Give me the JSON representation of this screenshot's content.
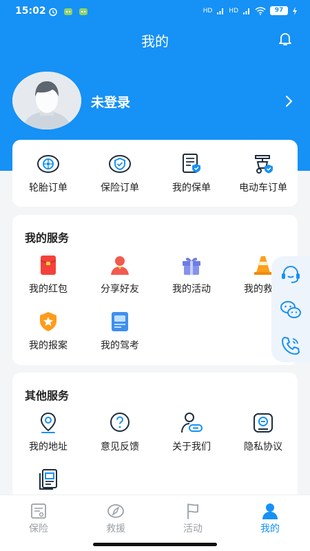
{
  "status_bar": {
    "time": "15:02",
    "battery": "97",
    "network_labels": [
      "HD",
      "HD"
    ]
  },
  "header": {
    "title": "我的",
    "bell_icon": "bell-icon"
  },
  "profile": {
    "name": "未登录",
    "avatar_icon": "avatar-placeholder-icon",
    "chevron_icon": "chevron-right-icon"
  },
  "orders": {
    "items": [
      {
        "label": "轮胎订单",
        "icon": "tire-icon"
      },
      {
        "label": "保险订单",
        "icon": "insurance-shield-icon"
      },
      {
        "label": "我的保单",
        "icon": "policy-document-icon"
      },
      {
        "label": "电动车订单",
        "icon": "ebike-icon"
      }
    ]
  },
  "my_services": {
    "title": "我的服务",
    "items": [
      {
        "label": "我的红包",
        "icon": "red-packet-icon"
      },
      {
        "label": "分享好友",
        "icon": "share-friend-icon"
      },
      {
        "label": "我的活动",
        "icon": "gift-icon"
      },
      {
        "label": "我的救援",
        "icon": "traffic-cone-icon"
      },
      {
        "label": "我的报案",
        "icon": "report-shield-icon"
      },
      {
        "label": "我的驾考",
        "icon": "driving-test-icon"
      }
    ]
  },
  "other_services": {
    "title": "其他服务",
    "items": [
      {
        "label": "我的地址",
        "icon": "location-pin-icon"
      },
      {
        "label": "意见反馈",
        "icon": "feedback-question-icon"
      },
      {
        "label": "关于我们",
        "icon": "about-us-icon"
      },
      {
        "label": "隐私协议",
        "icon": "privacy-icon"
      },
      {
        "label": "",
        "icon": "agreement-document-icon"
      }
    ]
  },
  "floating_panel": {
    "icons": [
      "customer-service-icon",
      "wechat-icon",
      "phone-icon"
    ]
  },
  "tab_bar": {
    "tabs": [
      {
        "label": "保险",
        "icon": "insurance-tab-icon",
        "active": false
      },
      {
        "label": "救援",
        "icon": "rescue-compass-icon",
        "active": false
      },
      {
        "label": "活动",
        "icon": "activity-flag-icon",
        "active": false
      },
      {
        "label": "我的",
        "icon": "me-person-icon",
        "active": true
      }
    ]
  },
  "colors": {
    "primary": "#1691f5",
    "background": "#f4f5f7",
    "card": "#ffffff",
    "text": "#222222",
    "tab_inactive": "#9aa0a6"
  }
}
